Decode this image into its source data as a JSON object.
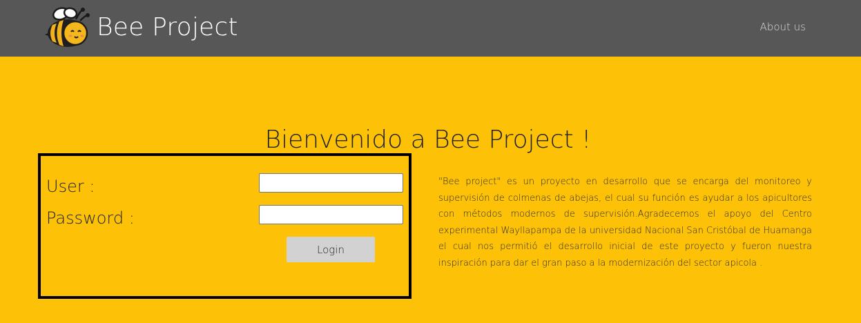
{
  "navbar": {
    "brand_title": "Bee Project",
    "logo_icon": "bee-icon",
    "about_label": "About us",
    "background_color": "#575757"
  },
  "main": {
    "background_color": "#fdc208",
    "welcome_title": "Bienvenido a Bee Project !",
    "login": {
      "user_label": "User :",
      "user_value": "",
      "password_label": "Password :",
      "password_value": "",
      "button_label": "Login"
    },
    "description": "\"Bee project\" es un proyecto en desarrollo que se encarga del monitoreo y supervisión de colmenas de abejas, el cual su función es ayudar a los apicultores con métodos modernos de supervisión.Agradecemos el apoyo del Centro experimental Wayllapampa de la universidad Nacional San Cristóbal de Huamanga el cual nos permitió el desarrollo inicial de este proyecto y fueron nuestra inspiración para dar el gran paso a la modernización del sector apicola ."
  }
}
